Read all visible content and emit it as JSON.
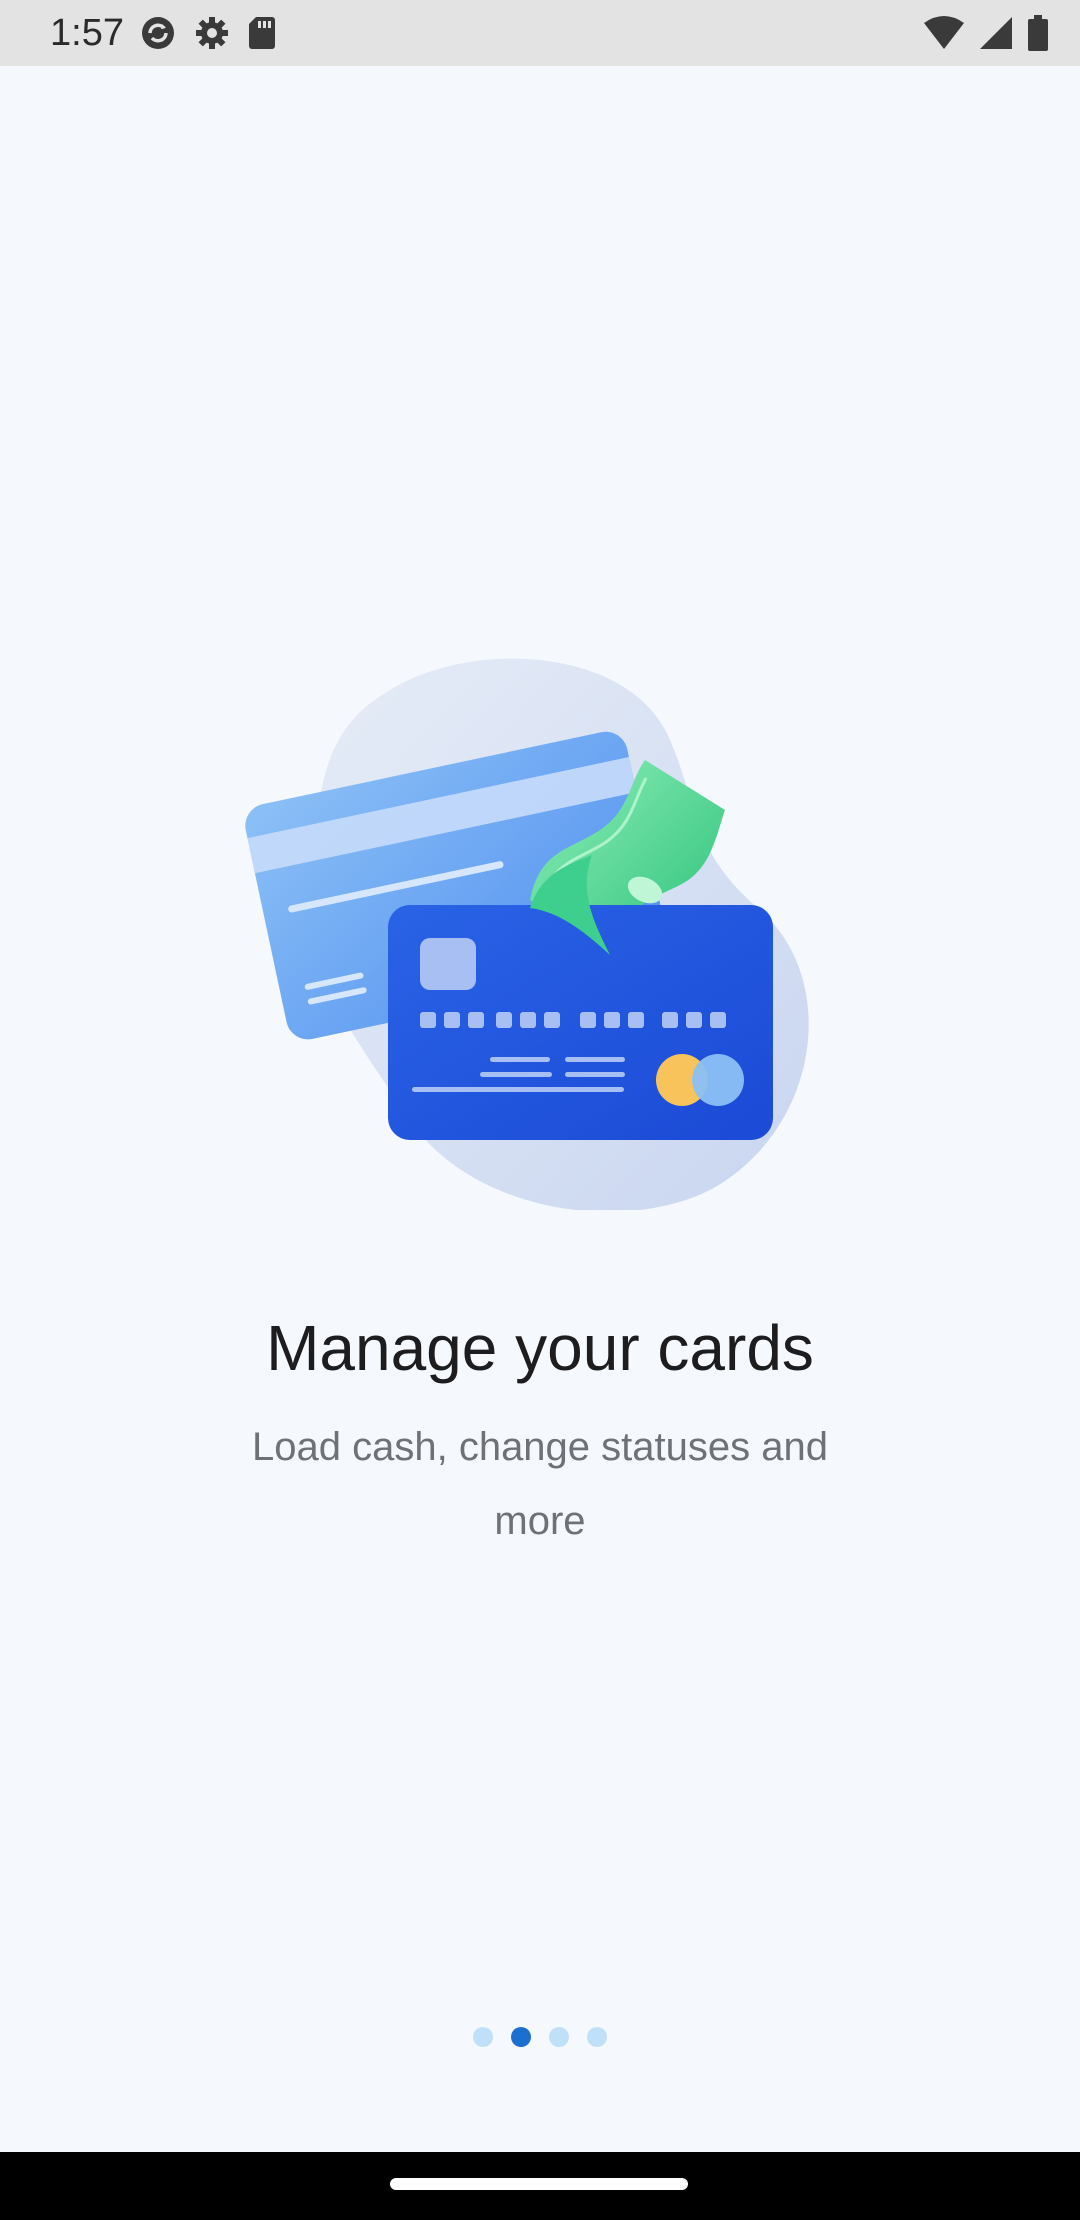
{
  "status_bar": {
    "time": "1:57",
    "left_icons": [
      "sync-icon",
      "gear-icon",
      "sd-card-icon"
    ],
    "right_icons": [
      "wifi-icon",
      "cellular-signal-icon",
      "battery-icon"
    ]
  },
  "onboarding": {
    "illustration": "credit-cards-with-cash-illustration",
    "title": "Manage your cards",
    "subtitle": "Load cash, change statuses and more"
  },
  "pager": {
    "total_pages": 4,
    "active_index": 1,
    "active_color": "#1b6fd1",
    "inactive_color": "#bfe0f8"
  },
  "colors": {
    "background": "#f5f9fd",
    "card_front": "#1f57e0",
    "card_back": "#6aa6f2",
    "cash": "#3ecf8e"
  }
}
